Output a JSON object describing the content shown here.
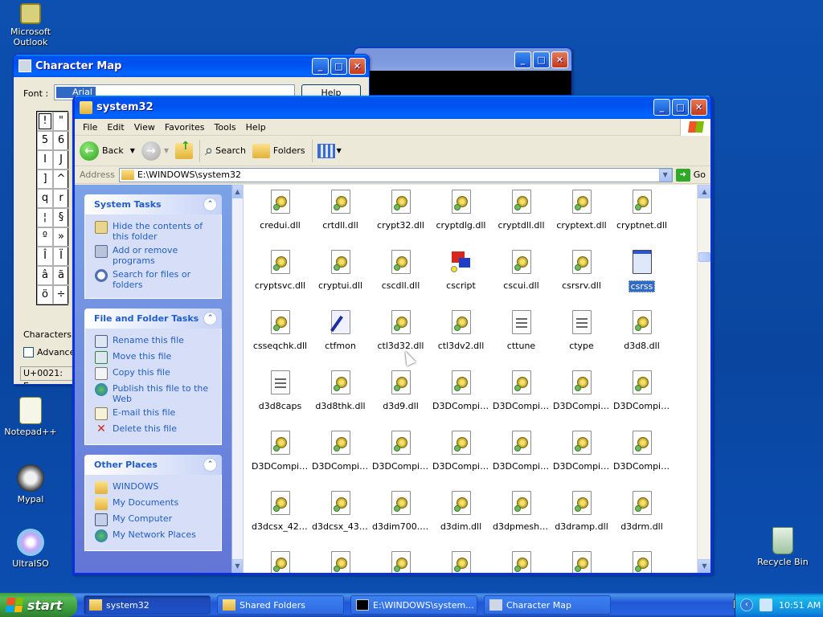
{
  "desktop": {
    "icons": [
      {
        "label": "Microsoft Outlook"
      },
      {
        "label": "Notepad++"
      },
      {
        "label": "Mypal"
      },
      {
        "label": "UltraISO"
      },
      {
        "label": "Recycle Bin"
      }
    ]
  },
  "charmap": {
    "title": "Character Map",
    "font_label": "Font :",
    "font_value": "Arial",
    "help_label": "Help",
    "chars": [
      "!",
      "\"",
      "5",
      "6",
      "I",
      "J",
      "]",
      "^",
      "q",
      "r",
      "¦",
      "§",
      "º",
      "»",
      "Î",
      "Ï",
      "â",
      "ã",
      "ö",
      "÷"
    ],
    "chars_to_copy_label": "Characters to",
    "advanced_label": "Advance",
    "status": "U+0021: Exc"
  },
  "explorer": {
    "title": "system32",
    "menu": [
      "File",
      "Edit",
      "View",
      "Favorites",
      "Tools",
      "Help"
    ],
    "toolbar": {
      "back": "Back",
      "search": "Search",
      "folders": "Folders"
    },
    "address_label": "Address",
    "address_value": "E:\\WINDOWS\\system32",
    "go_label": "Go",
    "system_tasks": {
      "title": "System Tasks",
      "items": [
        "Hide the contents of this folder",
        "Add or remove programs",
        "Search for files or folders"
      ]
    },
    "file_tasks": {
      "title": "File and Folder Tasks",
      "items": [
        "Rename this file",
        "Move this file",
        "Copy this file",
        "Publish this file to the Web",
        "E-mail this file",
        "Delete this file"
      ]
    },
    "other_places": {
      "title": "Other Places",
      "items": [
        "WINDOWS",
        "My Documents",
        "My Computer",
        "My Network Places"
      ]
    },
    "files": [
      "credui.dll",
      "crtdll.dll",
      "crypt32.dll",
      "cryptdlg.dll",
      "cryptdll.dll",
      "cryptext.dll",
      "cryptnet.dll",
      "cryptsvc.dll",
      "cryptui.dll",
      "cscdll.dll",
      "cscript",
      "cscui.dll",
      "csrsrv.dll",
      "csrss",
      "csseqchk.dll",
      "ctfmon",
      "ctl3d32.dll",
      "ctl3dv2.dll",
      "cttune",
      "ctype",
      "d3d8.dll",
      "d3d8caps",
      "d3d8thk.dll",
      "d3d9.dll",
      "D3DCompil...",
      "D3DCompil...",
      "D3DCompil...",
      "D3DCompil...",
      "D3DCompil...",
      "D3DCompil...",
      "D3DCompil...",
      "D3DCompil...",
      "D3DCompil...",
      "D3DCompil...",
      "D3DCompil...",
      "d3dcsx_42.dll",
      "d3dcsx_43.dll",
      "d3dim700.dll",
      "d3dim.dll",
      "d3dpmesh.dll",
      "d3dramp.dll",
      "d3drm.dll"
    ],
    "selected_file": "csrss"
  },
  "taskbar": {
    "start": "start",
    "items": [
      "system32",
      "Shared Folders",
      "E:\\WINDOWS\\system...",
      "Character Map"
    ],
    "clock": "10:51 AM"
  }
}
